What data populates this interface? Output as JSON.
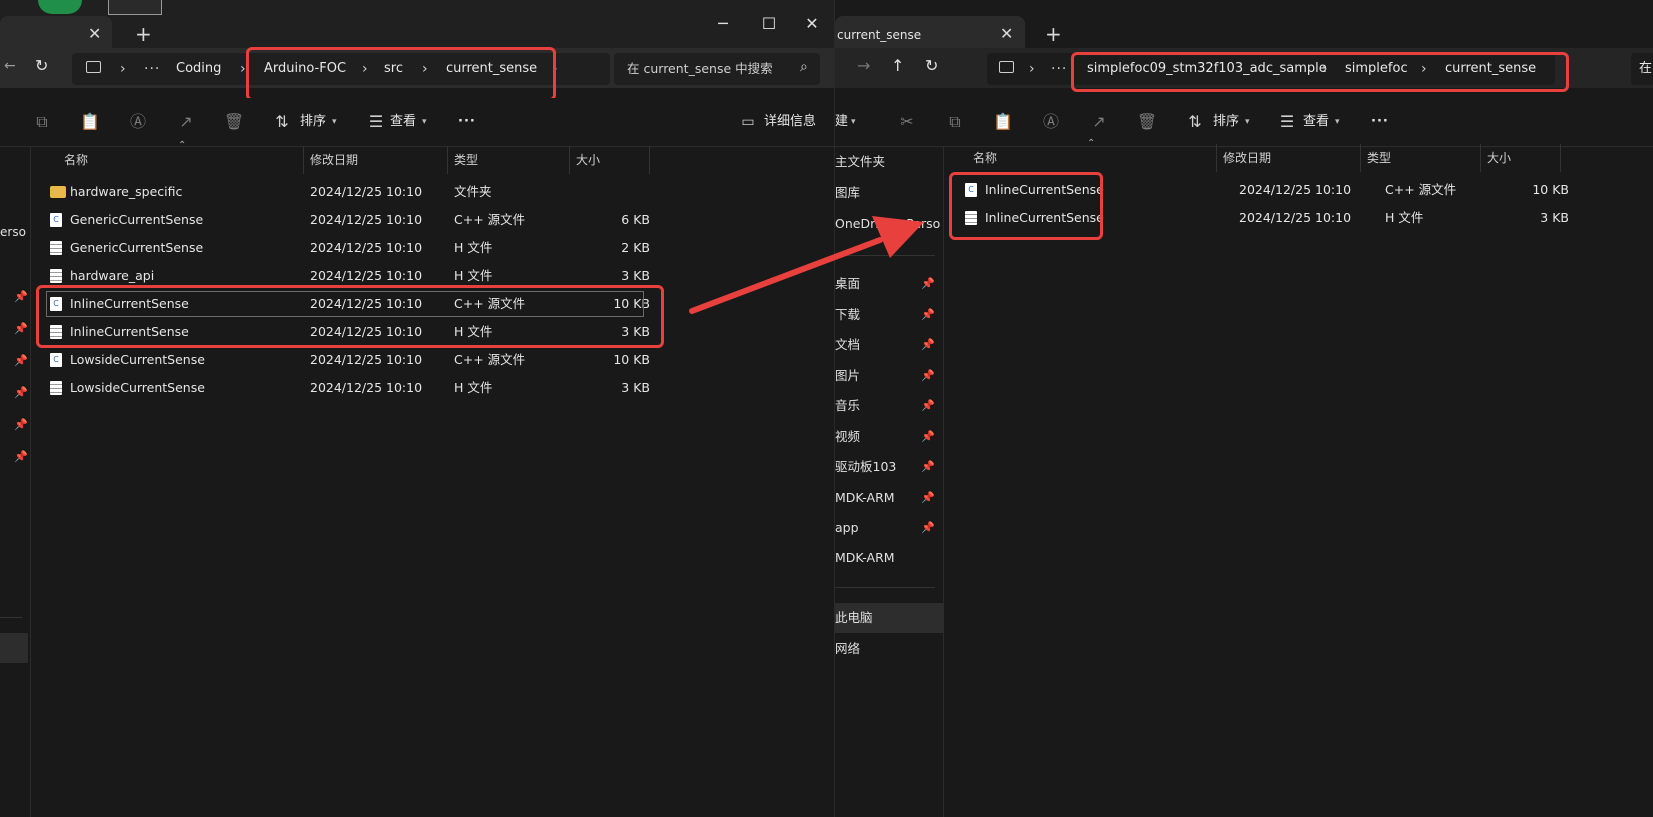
{
  "left": {
    "breadcrumb": [
      "Coding",
      "Arduino-FOC",
      "src",
      "current_sense"
    ],
    "search_placeholder": "在 current_sense 中搜索",
    "toolbar": {
      "sort": "排序",
      "view": "查看",
      "more": "···",
      "details": "详细信息"
    },
    "columns": [
      "名称",
      "修改日期",
      "类型",
      "大小"
    ],
    "files": [
      {
        "name": "hardware_specific",
        "date": "2024/12/25 10:10",
        "type": "文件夹",
        "size": "",
        "icon": "folder-icon"
      },
      {
        "name": "GenericCurrentSense",
        "date": "2024/12/25 10:10",
        "type": "C++ 源文件",
        "size": "6 KB",
        "icon": "cpp-file-icon"
      },
      {
        "name": "GenericCurrentSense",
        "date": "2024/12/25 10:10",
        "type": "H 文件",
        "size": "2 KB",
        "icon": "h-file-icon"
      },
      {
        "name": "hardware_api",
        "date": "2024/12/25 10:10",
        "type": "H 文件",
        "size": "3 KB",
        "icon": "h-file-icon"
      },
      {
        "name": "InlineCurrentSense",
        "date": "2024/12/25 10:10",
        "type": "C++ 源文件",
        "size": "10 KB",
        "icon": "cpp-file-icon"
      },
      {
        "name": "InlineCurrentSense",
        "date": "2024/12/25 10:10",
        "type": "H 文件",
        "size": "3 KB",
        "icon": "h-file-icon"
      },
      {
        "name": "LowsideCurrentSense",
        "date": "2024/12/25 10:10",
        "type": "C++ 源文件",
        "size": "10 KB",
        "icon": "cpp-file-icon"
      },
      {
        "name": "LowsideCurrentSense",
        "date": "2024/12/25 10:10",
        "type": "H 文件",
        "size": "3 KB",
        "icon": "h-file-icon"
      }
    ],
    "nav_cut_label": "erso"
  },
  "right": {
    "tab_title": "current_sense",
    "breadcrumb": [
      "simplefoc09_stm32f103_adc_sample",
      "simplefoc",
      "current_sense"
    ],
    "search_cut": "在",
    "toolbar": {
      "new": "建",
      "sort": "排序",
      "view": "查看",
      "more": "···"
    },
    "columns": [
      "名称",
      "修改日期",
      "类型",
      "大小"
    ],
    "files": [
      {
        "name": "InlineCurrentSense",
        "date": "2024/12/25 10:10",
        "type": "C++ 源文件",
        "size": "10 KB",
        "icon": "cpp-file-icon"
      },
      {
        "name": "InlineCurrentSense",
        "date": "2024/12/25 10:10",
        "type": "H 文件",
        "size": "3 KB",
        "icon": "h-file-icon"
      }
    ],
    "nav": [
      {
        "label": "主文件夹",
        "pinned": false
      },
      {
        "label": "图库",
        "pinned": false
      },
      {
        "label": "OneDrive - Perso",
        "pinned": false
      },
      {
        "label": "桌面",
        "pinned": true
      },
      {
        "label": "下载",
        "pinned": true
      },
      {
        "label": "文档",
        "pinned": true
      },
      {
        "label": "图片",
        "pinned": true
      },
      {
        "label": "音乐",
        "pinned": true
      },
      {
        "label": "视频",
        "pinned": true
      },
      {
        "label": "驱动板103",
        "pinned": true
      },
      {
        "label": "MDK-ARM",
        "pinned": true
      },
      {
        "label": "app",
        "pinned": true
      },
      {
        "label": "MDK-ARM",
        "pinned": false
      },
      {
        "label": "此电脑",
        "pinned": false
      },
      {
        "label": "网络",
        "pinned": false
      }
    ]
  },
  "colors": {
    "highlight": "#e8403c",
    "background": "#191919",
    "folder": "#e8b949"
  }
}
